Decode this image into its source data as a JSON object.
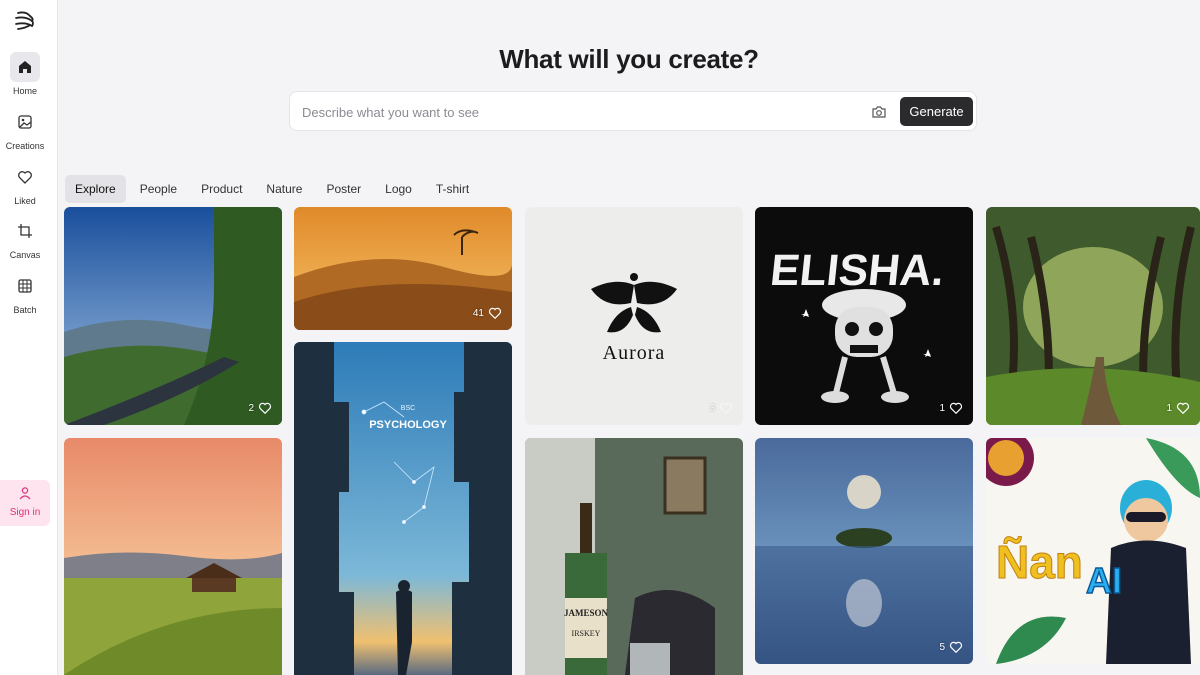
{
  "sidebar": {
    "items": [
      {
        "label": "Home",
        "icon": "home-icon"
      },
      {
        "label": "Creations",
        "icon": "image-icon"
      },
      {
        "label": "Liked",
        "icon": "heart-icon"
      },
      {
        "label": "Canvas",
        "icon": "crop-icon"
      },
      {
        "label": "Batch",
        "icon": "batch-icon"
      }
    ],
    "signin_label": "Sign in"
  },
  "header": {
    "title": "What will you create?"
  },
  "search": {
    "placeholder": "Describe what you want to see",
    "value": "",
    "generate_label": "Generate"
  },
  "tabs": [
    "Explore",
    "People",
    "Product",
    "Nature",
    "Poster",
    "Logo",
    "T-shirt"
  ],
  "gallery": {
    "cards": [
      {
        "subject": "mountain road landscape",
        "likes": "2"
      },
      {
        "subject": "desert dunes",
        "likes": "41"
      },
      {
        "subject": "Aurora logo",
        "likes": "3",
        "text": "Aurora"
      },
      {
        "subject": "Elisha skull t-shirt",
        "likes": "1",
        "text": "ELISHA."
      },
      {
        "subject": "forest path",
        "likes": "1"
      },
      {
        "subject": "rice field sunset",
        "likes": ""
      },
      {
        "subject": "psychology poster",
        "likes": "",
        "text_small": "BSC",
        "text": "PSYCHOLOGY"
      },
      {
        "subject": "whiskey bottle",
        "likes": "",
        "text": "JAMESON",
        "text2": "IRSKEY"
      },
      {
        "subject": "moon over lake",
        "likes": "5"
      },
      {
        "subject": "cartoon superhero",
        "likes": "",
        "text": "Ñan",
        "text2": "AI"
      }
    ]
  },
  "colors": {
    "accent": "#2b2b2e",
    "signin": "#e0307a",
    "signin_bg": "#fde4ef"
  }
}
